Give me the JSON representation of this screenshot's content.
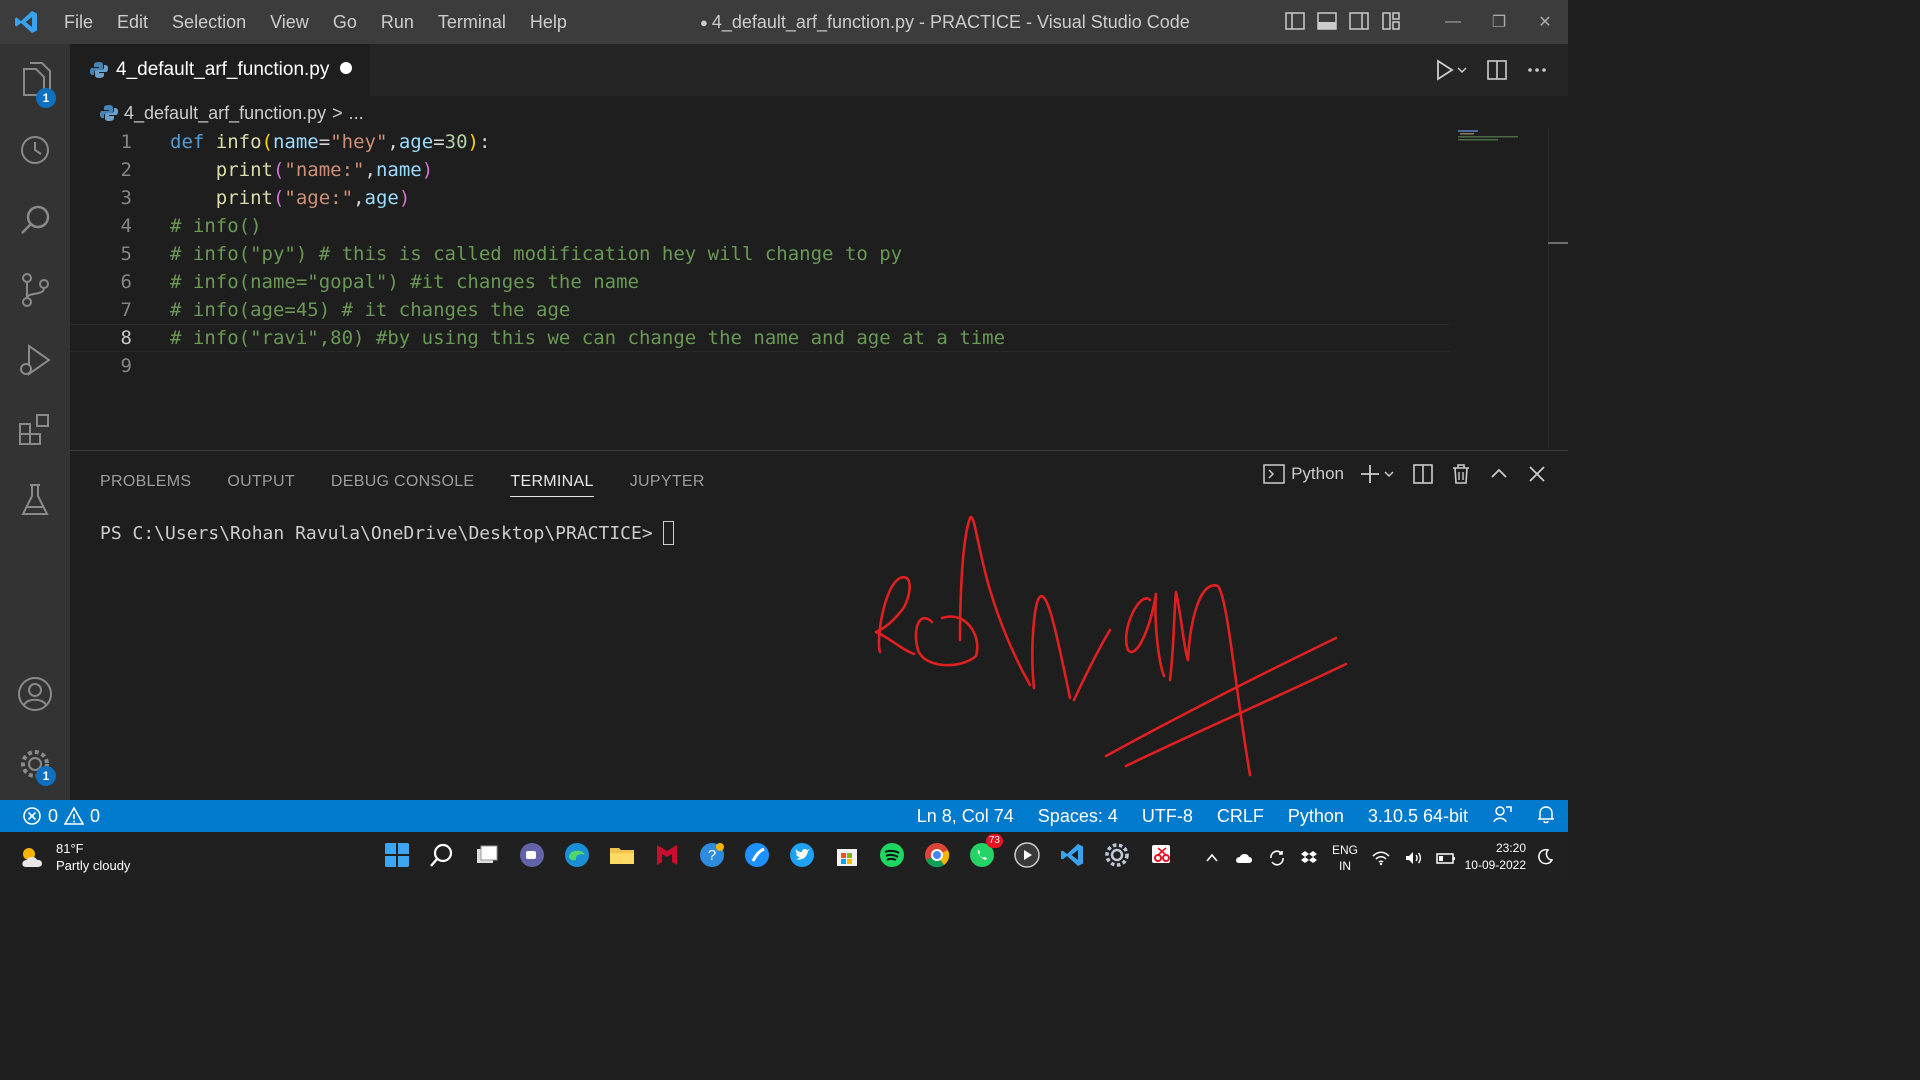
{
  "window": {
    "title_dirty_marker": "●",
    "title": "4_default_arf_function.py - PRACTICE - Visual Studio Code"
  },
  "menu": [
    "File",
    "Edit",
    "Selection",
    "View",
    "Go",
    "Run",
    "Terminal",
    "Help"
  ],
  "activity_bar": {
    "explorer_badge": "1",
    "settings_badge": "1"
  },
  "tab": {
    "label": "4_default_arf_function.py"
  },
  "breadcrumb": {
    "file": "4_default_arf_function.py",
    "separator": ">",
    "more": "..."
  },
  "editor": {
    "line_numbers": [
      "1",
      "2",
      "3",
      "4",
      "5",
      "6",
      "7",
      "8",
      "9"
    ],
    "active_line": 8,
    "lines": [
      "def info(name=\"hey\",age=30):",
      "    print(\"name:\",name)",
      "    print(\"age:\",age)",
      "# info()",
      "# info(\"py\") # this is called modification hey will change to py",
      "# info(name=\"gopal\") #it changes the name",
      "# info(age=45) # it changes the age",
      "# info(\"ravi\",80) #by using this we can change the name and age at a time",
      ""
    ]
  },
  "panel": {
    "tabs": [
      "PROBLEMS",
      "OUTPUT",
      "DEBUG CONSOLE",
      "TERMINAL",
      "JUPYTER"
    ],
    "active_tab": "TERMINAL",
    "terminal_profile": "Python",
    "prompt": "PS C:\\Users\\Rohan Ravula\\OneDrive\\Desktop\\PRACTICE>"
  },
  "statusbar": {
    "errors": "0",
    "warnings": "0",
    "position": "Ln 8, Col 74",
    "spaces": "Spaces: 4",
    "encoding": "UTF-8",
    "eol": "CRLF",
    "language": "Python",
    "interpreter": "3.10.5 64-bit"
  },
  "taskbar": {
    "temperature": "81°F",
    "weather": "Partly cloudy",
    "whatsapp_badge": "73",
    "lang_top": "ENG",
    "lang_bottom": "IN",
    "time": "23:20",
    "date": "10-09-2022"
  },
  "colors": {
    "status_bar": "#007acc",
    "title_bar": "#3c3c3c",
    "activity_bar": "#333333",
    "editor_bg": "#1e1e1e",
    "signature_ink": "#e02020"
  }
}
